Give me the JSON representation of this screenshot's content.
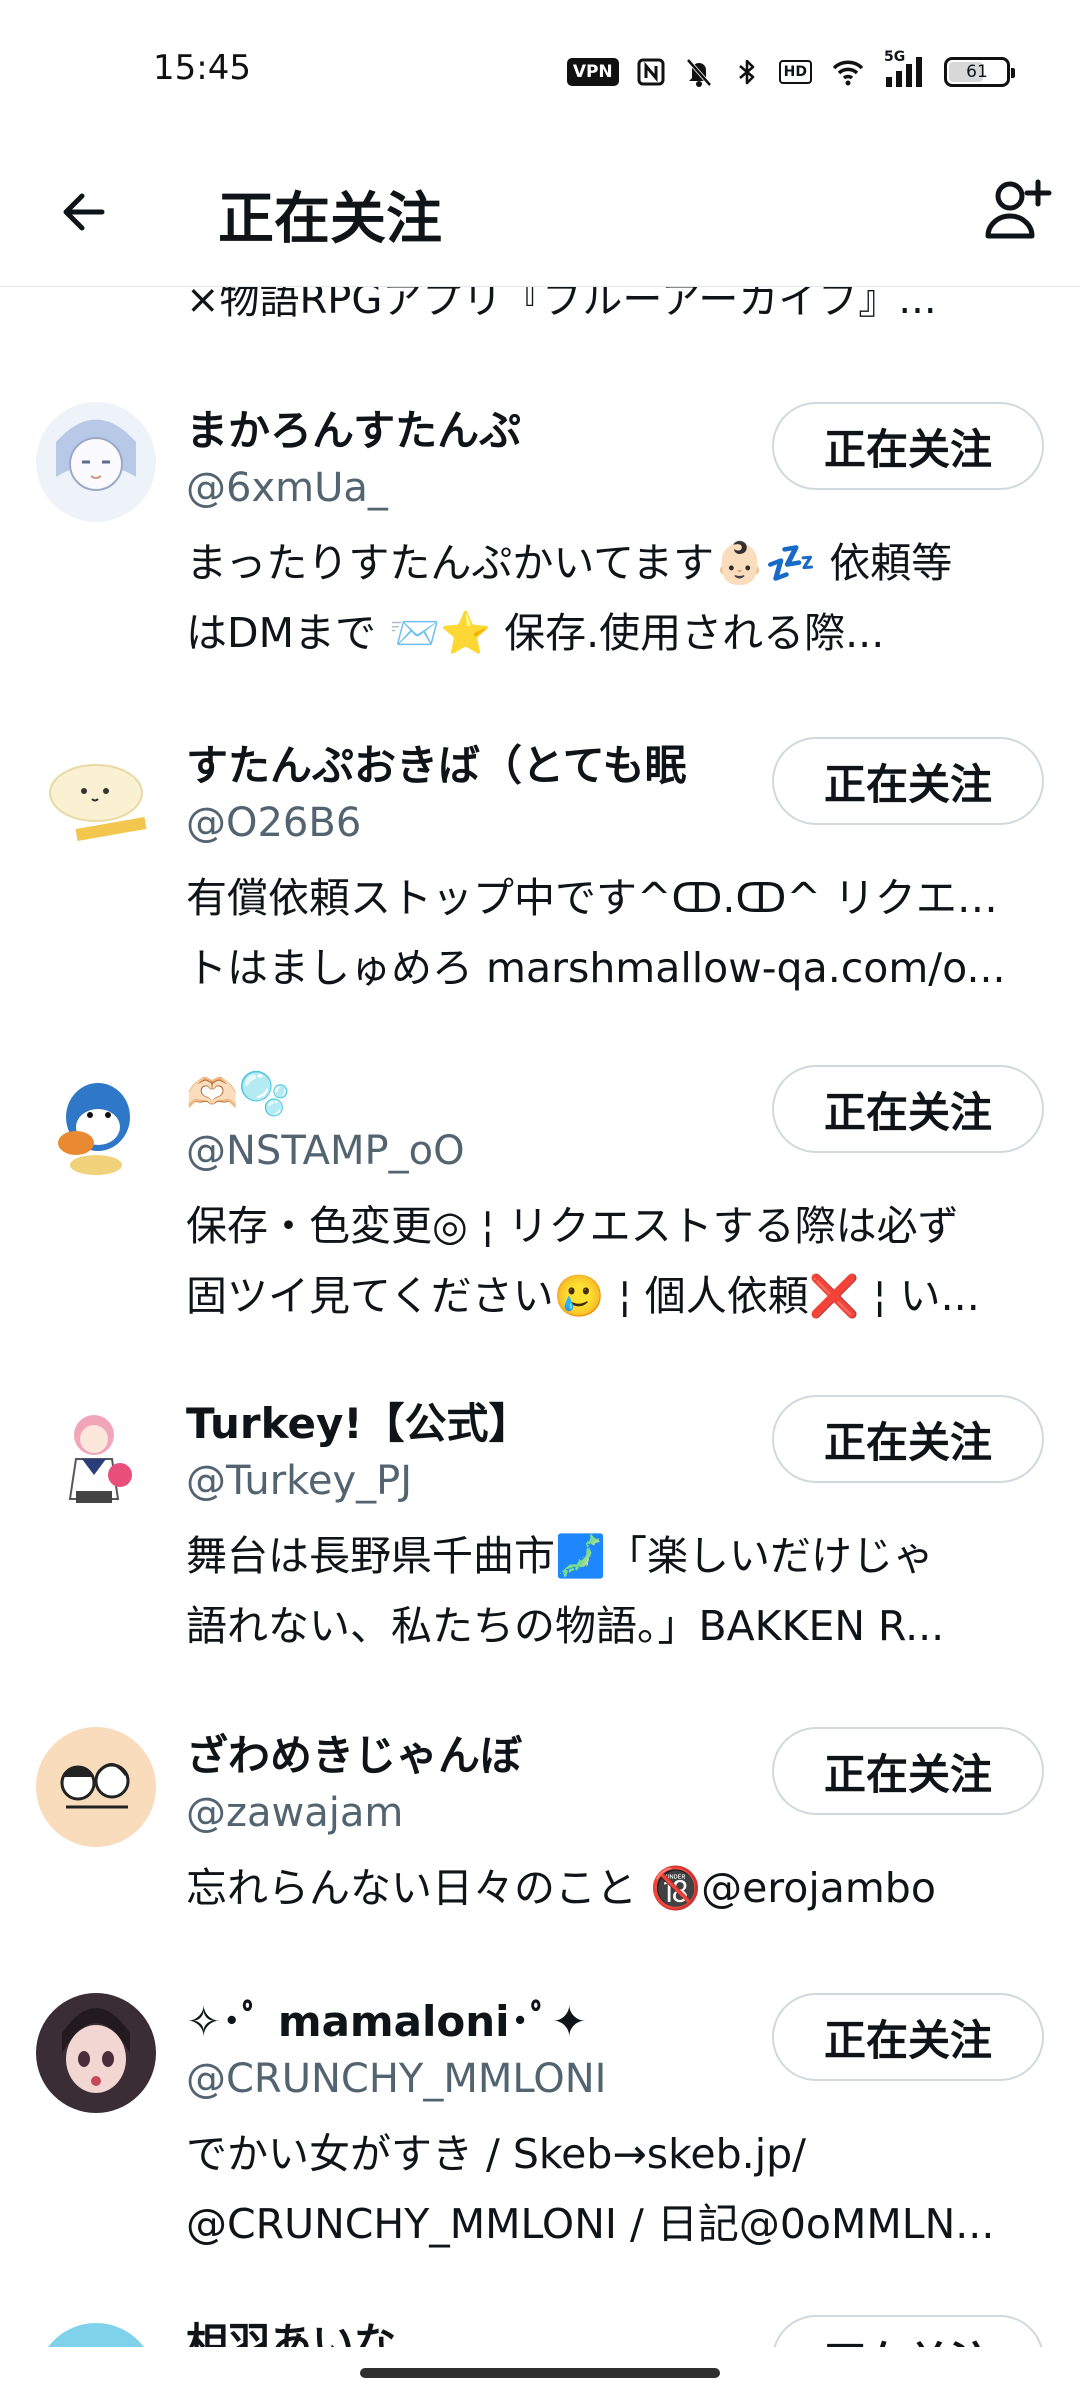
{
  "status_bar": {
    "time": "15:45",
    "vpn": "VPN",
    "hd": "HD",
    "network": "5G",
    "battery": "61",
    "battery_level": 0.61,
    "icons": [
      "vpn-icon",
      "nfc-icon",
      "bell-off-icon",
      "bluetooth-icon",
      "hd-icon",
      "wifi-icon",
      "signal-5g-icon",
      "battery-icon"
    ]
  },
  "header": {
    "title": "正在关注",
    "back_icon": "arrow-left-icon",
    "add_user_icon": "add-user-icon"
  },
  "list": {
    "partial_top_bio": "×物語RPGアプリ『ブルーアーカイブ』...",
    "users": [
      {
        "name": "まかろんすたんぷ",
        "handle": "@6xmUa_",
        "bio_lines": [
          "まったりすたんぷかいてます👶🏻💤 依頼等",
          "はDMまで 📨⭐️          保存.使用される際..."
        ],
        "follow_label": "正在关注",
        "avatar_color": "#dfe8f3"
      },
      {
        "name": "すたんぷおきば（とても眠",
        "handle": "@O26B6",
        "bio_lines": [
          "有償依頼ストップ中です^ↀ.ↀ^ リクエスト",
          "トはましゅめろ marshmallow-qa.com/o..."
        ],
        "follow_label": "正在关注",
        "avatar_color": "#f7efd0"
      },
      {
        "name": "🫶🏻🫧",
        "handle": "@NSTAMP_oO",
        "bio_lines": [
          "保存・色変更◎ ¦ リクエストする際は必ず",
          "固ツイ見てください🥲 ¦ 個人依頼❌ ¦ い..."
        ],
        "follow_label": "正在关注",
        "avatar_color": "#d6ecfa"
      },
      {
        "name": "Turkey!【公式】",
        "handle": "@Turkey_PJ",
        "bio_lines": [
          "舞台は長野県千曲市🗾「楽しいだけじゃ",
          "語れない、私たちの物語。」BAKKEN R..."
        ],
        "follow_label": "正在关注",
        "avatar_color": "#fbe3ec"
      },
      {
        "name": "ざわめきじゃんぼ",
        "handle": "@zawajam",
        "bio_lines": [
          "忘れらんない日々のこと 🔞@erojambo"
        ],
        "follow_label": "正在关注",
        "avatar_color": "#f6dcc0"
      },
      {
        "name": "✧･ﾟ mamaloni･ﾟ✦",
        "handle": "@CRUNCHY_MMLONI",
        "bio_lines": [
          "でかい女がすき / Skeb→skeb.jp/",
          "@CRUNCHY_MMLONI / 日記@0oMMLN..."
        ],
        "follow_label": "正在关注",
        "avatar_color": "#3a2e34"
      }
    ],
    "partial_bottom": {
      "name": "相羽あいな",
      "follow_label": "正在关注"
    }
  }
}
